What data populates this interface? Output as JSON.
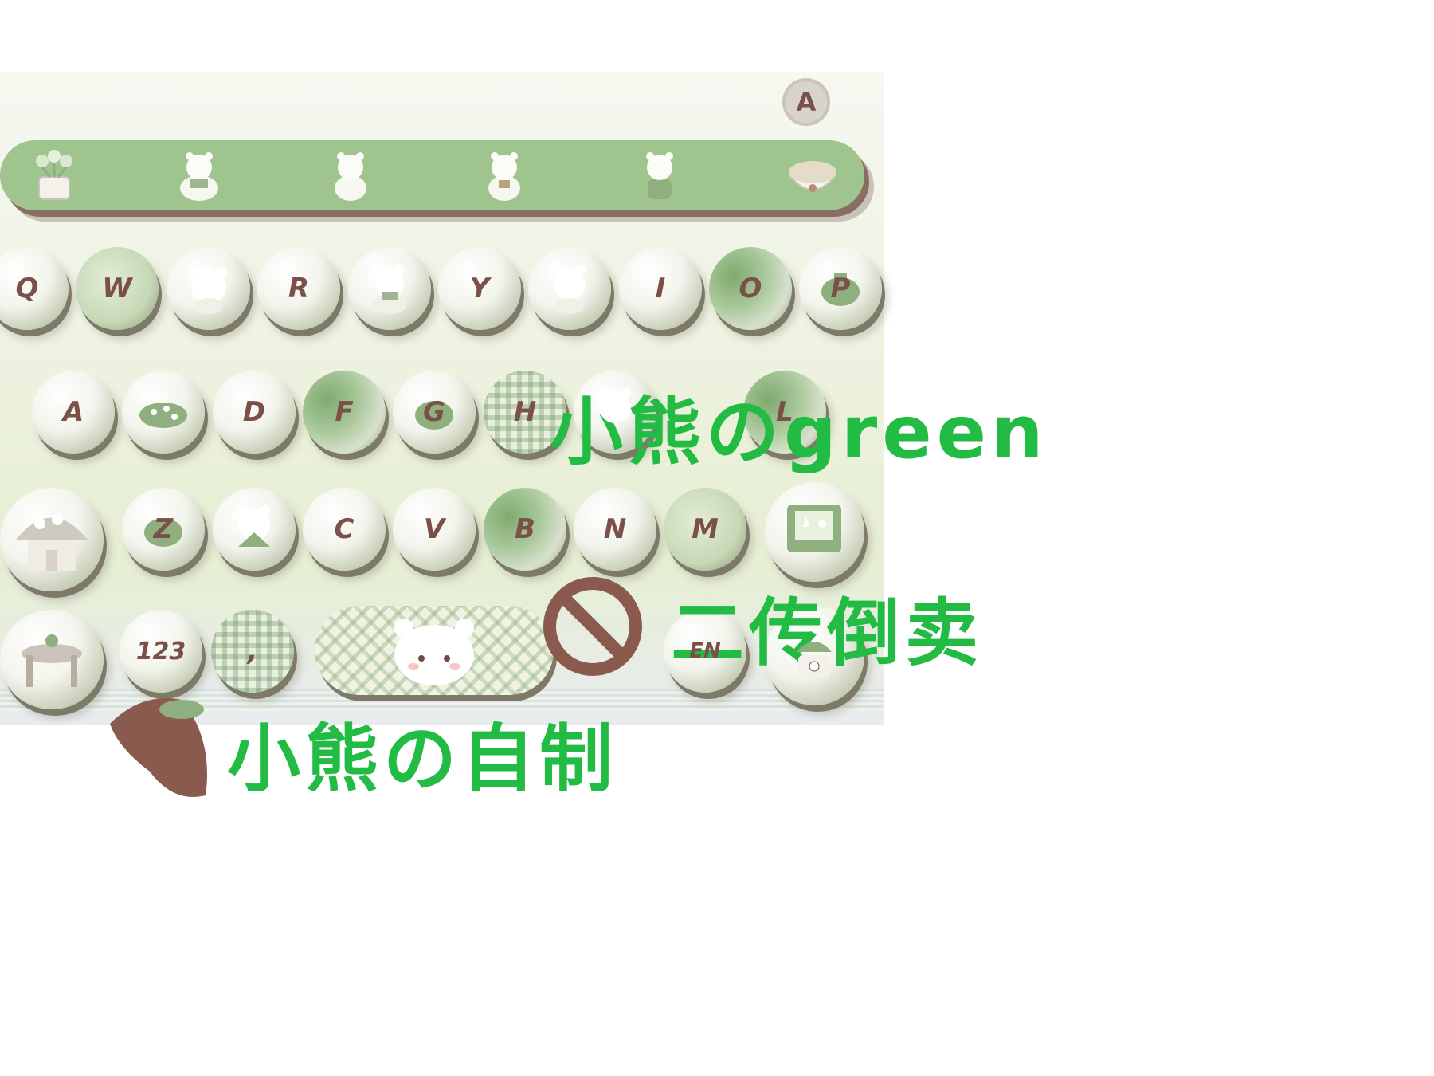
{
  "keyboard": {
    "toggle_key": "A",
    "toolbar_icons": [
      "flower-pot-icon",
      "bear-sitting-icon",
      "bear-icon",
      "bear-cup-icon",
      "bear-standing-icon",
      "basket-icon"
    ],
    "row1": [
      "Q",
      "W",
      "",
      "R",
      "",
      "Y",
      "",
      "I",
      "O",
      "P"
    ],
    "row2": [
      "A",
      "",
      "D",
      "F",
      "G",
      "H",
      "",
      "L"
    ],
    "row3": [
      "",
      "Z",
      "",
      "C",
      "V",
      "B",
      "N",
      "M",
      ""
    ],
    "row4": {
      "table": "",
      "num": "123",
      "comma": ",",
      "space": "",
      "en": "EN",
      "enter": ""
    }
  },
  "promo": {
    "line1": "小熊のgreen",
    "line2": "二传倒卖",
    "line3": "小熊の自制"
  },
  "colors": {
    "promo_green": "#22bb44",
    "toolbar_green": "#9fc48e",
    "key_text_brown": "#7a5048",
    "ban_brown": "#8a5a4e"
  }
}
